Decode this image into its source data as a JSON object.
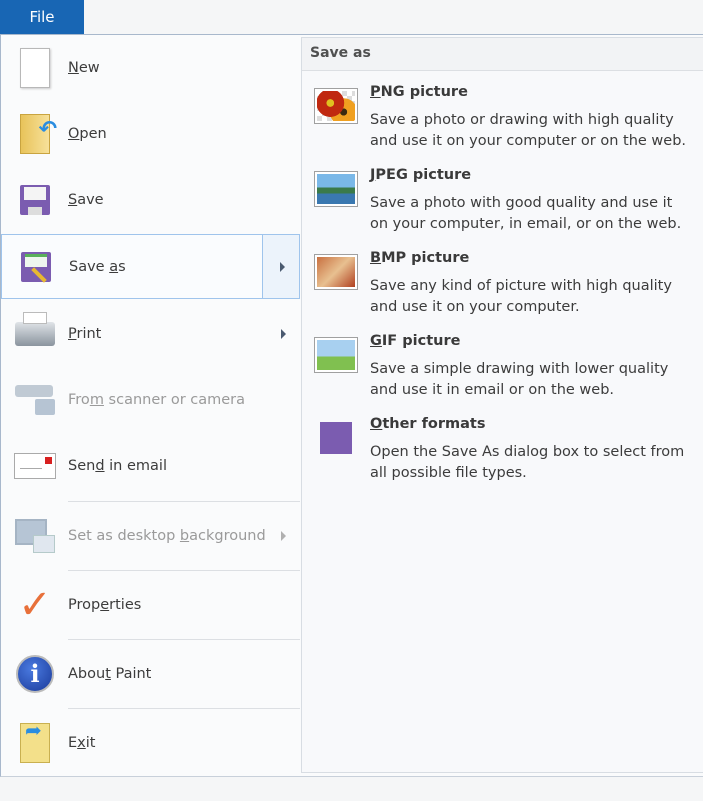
{
  "file_tab": "File",
  "left_menu": [
    {
      "pre": "",
      "key": "N",
      "post": "ew",
      "icon": "new-document-icon"
    },
    {
      "pre": "",
      "key": "O",
      "post": "pen",
      "icon": "open-folder-icon"
    },
    {
      "pre": "",
      "key": "S",
      "post": "ave",
      "icon": "save-floppy-icon"
    },
    {
      "pre": "Save ",
      "key": "a",
      "post": "s",
      "icon": "save-as-icon",
      "selected": true,
      "submenu": true
    },
    {
      "pre": "",
      "key": "P",
      "post": "rint",
      "icon": "printer-icon",
      "submenu": true
    },
    {
      "pre": "Fro",
      "key": "m",
      "post": " scanner or camera",
      "icon": "scanner-camera-icon",
      "disabled": true
    },
    {
      "pre": "Sen",
      "key": "d",
      "post": " in email",
      "icon": "email-icon"
    },
    {
      "pre": "Set as desktop ",
      "key": "b",
      "post": "ackground",
      "icon": "desktop-background-icon",
      "disabled": true,
      "submenu": true
    },
    {
      "pre": "Prop",
      "key": "e",
      "post": "rties",
      "icon": "properties-check-icon"
    },
    {
      "pre": "Abou",
      "key": "t",
      "post": " Paint",
      "icon": "info-icon"
    },
    {
      "pre": "E",
      "key": "x",
      "post": "it",
      "icon": "exit-icon"
    }
  ],
  "save_as_panel": {
    "title": "Save as",
    "formats": [
      {
        "key": "P",
        "title": "NG picture",
        "desc": "Save a photo or drawing with high quality and use it on your computer or on the web.",
        "icon": "png-picture-icon"
      },
      {
        "key": "J",
        "title": "PEG picture",
        "desc": "Save a photo with good quality and use it on your computer, in email, or on the web.",
        "icon": "jpeg-picture-icon"
      },
      {
        "key": "B",
        "title": "MP picture",
        "desc": "Save any kind of picture with high quality and use it on your computer.",
        "icon": "bmp-picture-icon"
      },
      {
        "key": "G",
        "title": "IF picture",
        "desc": "Save a simple drawing with lower quality and use it in email or on the web.",
        "icon": "gif-picture-icon"
      },
      {
        "key": "O",
        "title": "ther formats",
        "desc": "Open the Save As dialog box to select from all possible file types.",
        "icon": "other-formats-icon"
      }
    ]
  },
  "colors": {
    "file_tab": "#1866b4",
    "selection_border": "#9fc4ec"
  }
}
